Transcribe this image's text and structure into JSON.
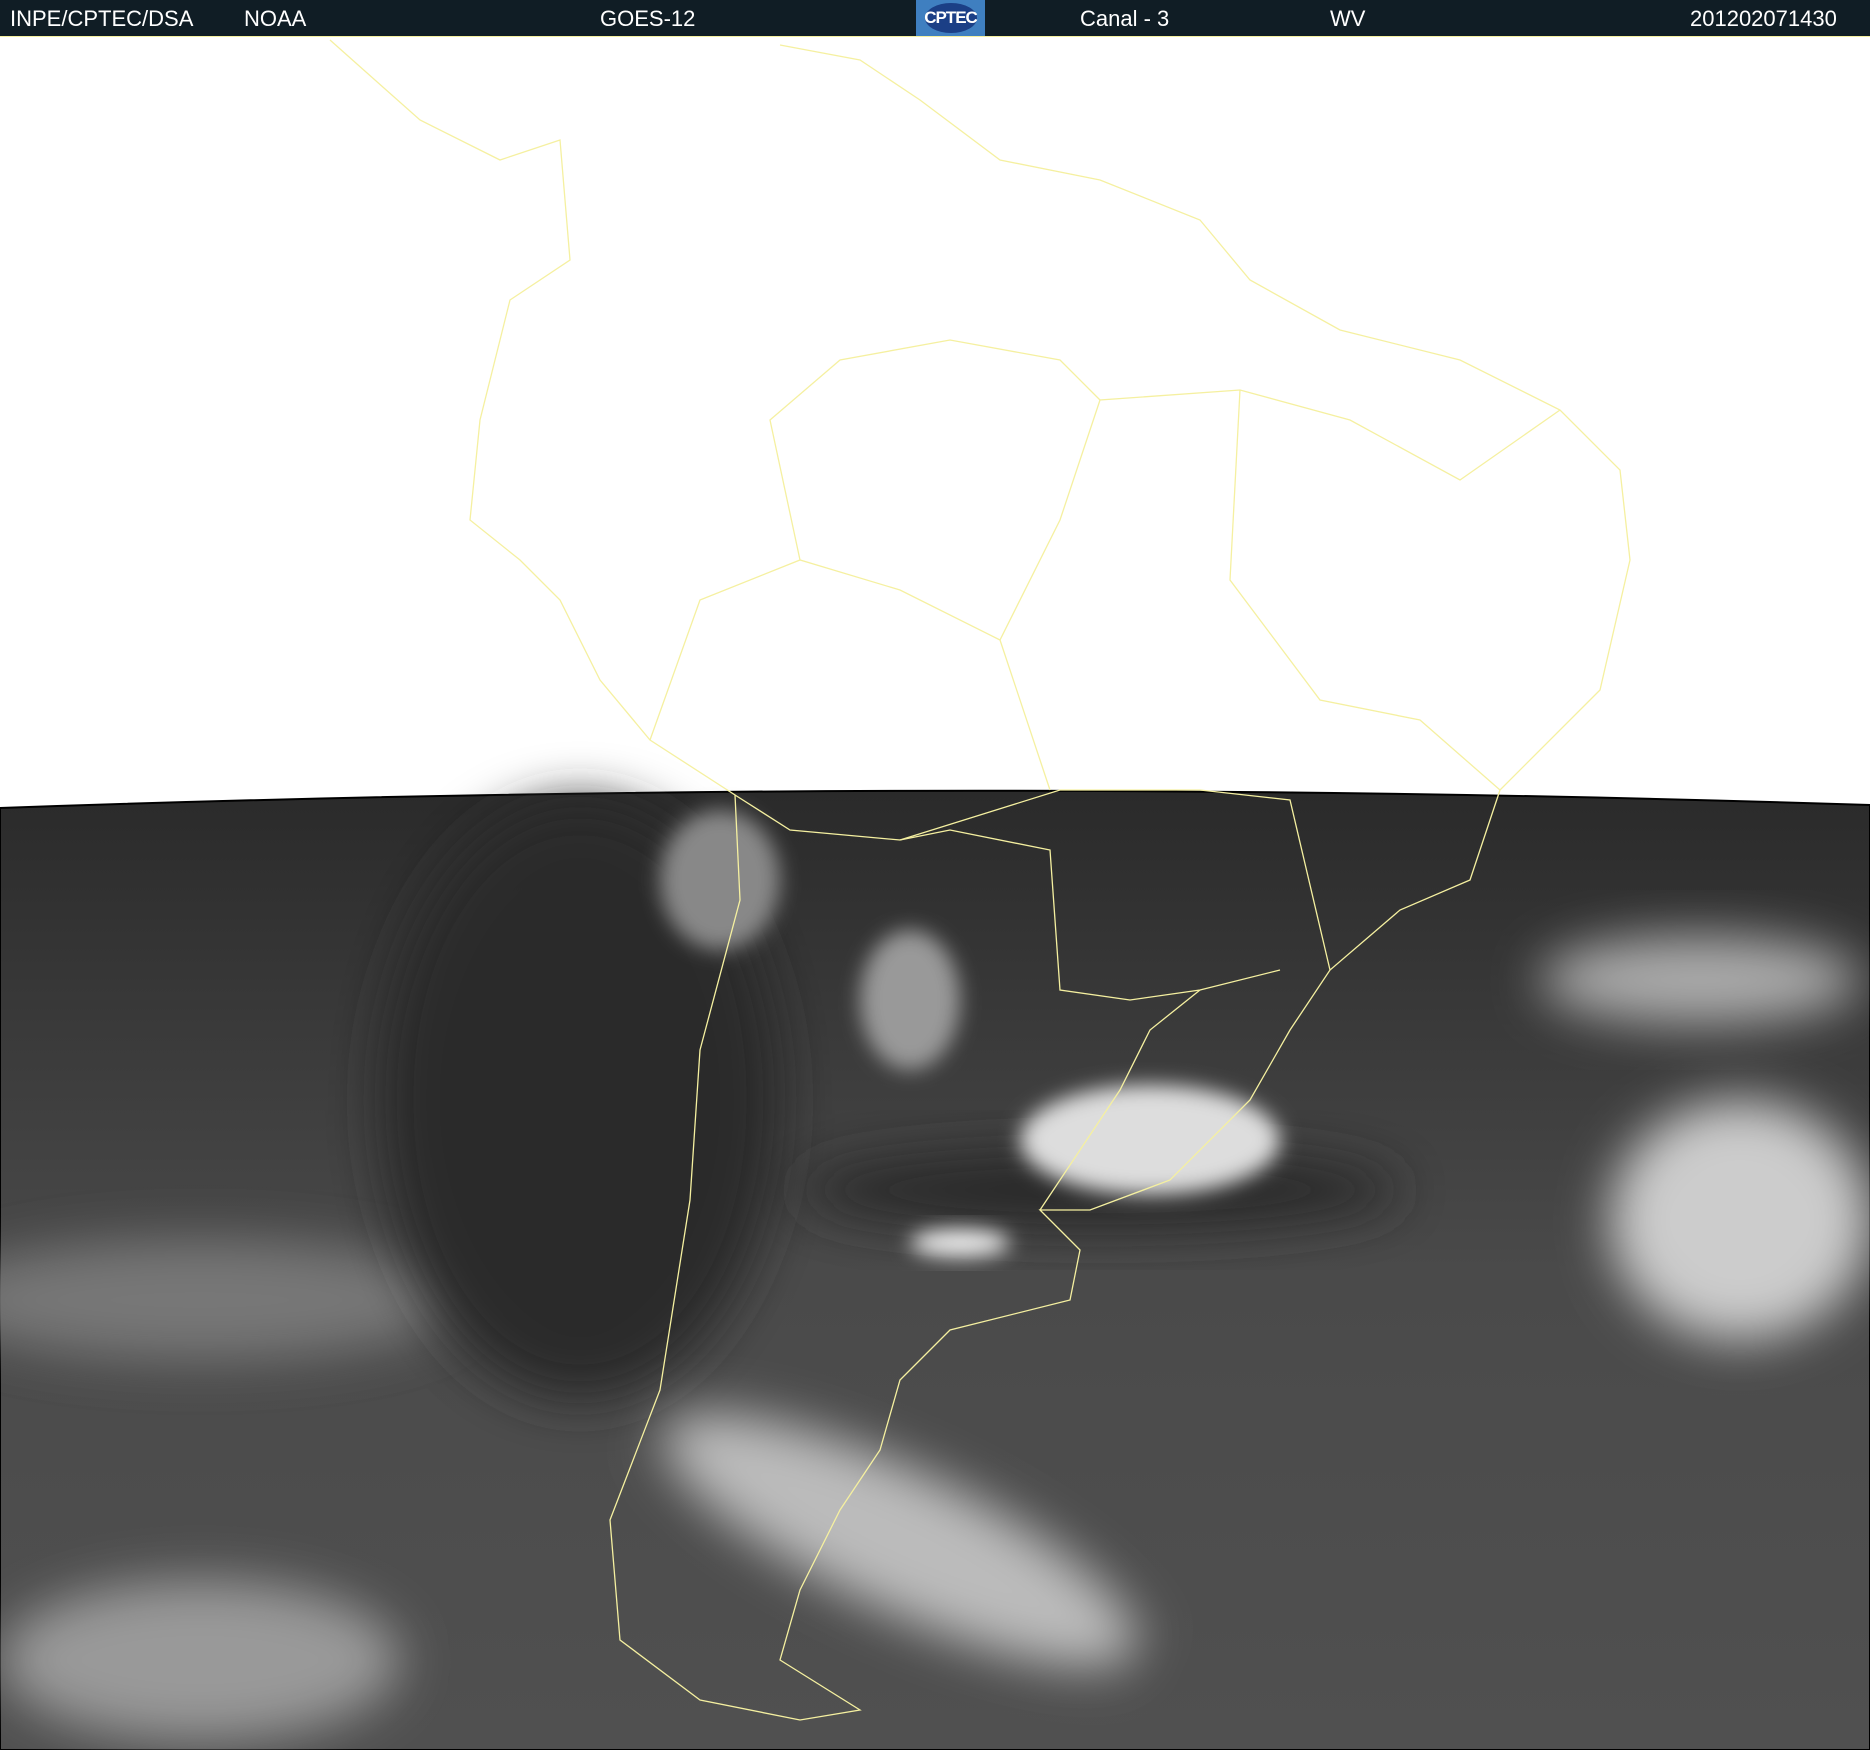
{
  "header": {
    "agency": "INPE/CPTEC/DSA",
    "partner": "NOAA",
    "satellite": "GOES-12",
    "logo_text": "CPTEC",
    "channel": "Canal - 3",
    "band": "WV",
    "timestamp": "201202071430"
  },
  "colors": {
    "header_bg": "#101d25",
    "coastline": "#f5f0a0",
    "logo_bg": "#3f7fc0"
  },
  "icons": {
    "logo": "cptec-logo"
  }
}
